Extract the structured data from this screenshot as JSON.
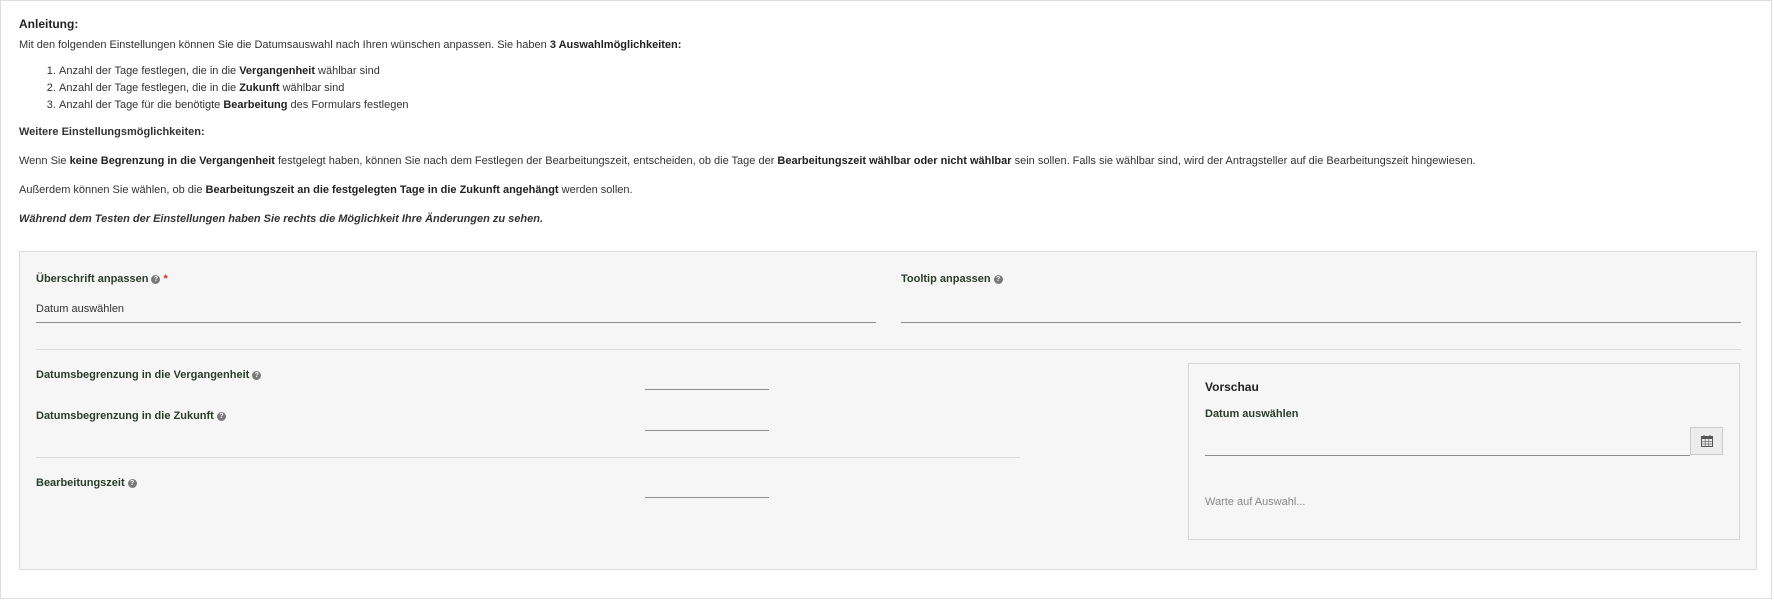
{
  "instructions": {
    "title": "Anleitung:",
    "intro_text": "Mit den folgenden Einstellungen können Sie die Datumsauswahl nach Ihren wünschen anpassen. Sie haben ",
    "intro_bold": "3 Auswahlmöglichkeiten:",
    "steps": [
      {
        "pre": "Anzahl der Tage festlegen, die in die ",
        "bold": "Vergangenheit",
        "post": " wählbar sind"
      },
      {
        "pre": "Anzahl der Tage festlegen, die in die ",
        "bold": "Zukunft",
        "post": " wählbar sind"
      },
      {
        "pre": "Anzahl der Tage für die benötigte ",
        "bold": "Bearbeitung",
        "post": " des Formulars festlegen"
      }
    ],
    "further_title": "Weitere Einstellungsmöglichkeiten:",
    "para1": {
      "t1": "Wenn Sie ",
      "b1": "keine Begrenzung in die Vergangenheit",
      "t2": " festgelegt haben, können Sie nach dem Festlegen der Bearbeitungszeit, entscheiden, ob die Tage der ",
      "b2": "Bearbeitungszeit wählbar oder nicht wählbar",
      "t3": " sein sollen. Falls sie wählbar sind, wird der Antragsteller auf die Bearbeitungszeit hingewiesen."
    },
    "para2": {
      "t1": "Außerdem können Sie wählen, ob die ",
      "b1": "Bearbeitungszeit an die festgelegten Tage in die Zukunft angehängt",
      "t2": " werden sollen."
    },
    "note": "Während dem Testen der Einstellungen haben Sie rechts die Möglichkeit Ihre Änderungen zu sehen."
  },
  "form": {
    "heading_label": "Überschrift anpassen",
    "heading_required_mark": "*",
    "heading_value": "Datum auswählen",
    "tooltip_label": "Tooltip anpassen",
    "tooltip_value": "",
    "past_limit_label": "Datumsbegrenzung in die Vergangenheit",
    "future_limit_label": "Datumsbegrenzung in die Zukunft",
    "processing_label": "Bearbeitungszeit",
    "help_glyph": "?"
  },
  "preview": {
    "title": "Vorschau",
    "field_label": "Datum auswählen",
    "date_value": "",
    "status": "Warte auf Auswahl..."
  },
  "colors": {
    "panel_bg": "#f6f6f6",
    "label": "#2b3d2b",
    "required": "#c0392b"
  }
}
